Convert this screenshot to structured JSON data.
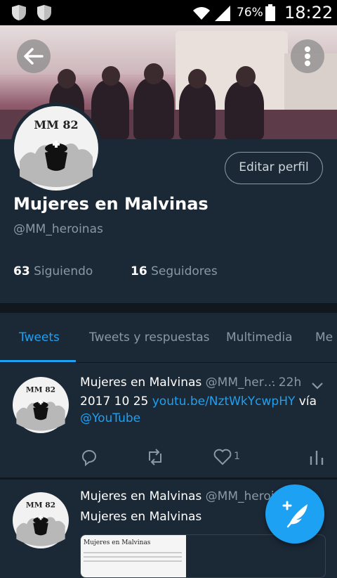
{
  "status_bar": {
    "battery": "76%",
    "time": "18:22",
    "icons": [
      "shield-icon",
      "shield-icon",
      "wifi-icon",
      "signal-icon",
      "battery-icon"
    ]
  },
  "header": {
    "back_icon": "arrow-left-icon",
    "more_icon": "more-vertical-icon"
  },
  "profile": {
    "avatar_text": "MM 82",
    "edit_button": "Editar perfil",
    "name": "Mujeres en Malvinas",
    "handle": "@MM_heroinas",
    "following_count": "63",
    "following_label": "Siguiendo",
    "followers_count": "16",
    "followers_label": "Seguidores"
  },
  "tabs": [
    {
      "label": "Tweets",
      "active": true
    },
    {
      "label": "Tweets y respuestas",
      "active": false
    },
    {
      "label": "Multimedia",
      "active": false
    },
    {
      "label": "Me",
      "active": false
    }
  ],
  "tweets": [
    {
      "author": "Mujeres en Malvinas",
      "handle": "@MM_her…",
      "time": "· 22h",
      "text_prefix": "2017 10 25 ",
      "link": "youtu.be/NztWkYcwpHY",
      "text_mid": " vía",
      "mention": "@YouTube",
      "like_count": "1"
    },
    {
      "author": "Mujeres en Malvinas",
      "handle": "@MM_heroi…",
      "text": "Mujeres en Malvinas",
      "card_title": "Mujeres en Malvinas"
    }
  ],
  "fab_icon": "compose-tweet-icon",
  "colors": {
    "background": "#1b2836",
    "accent": "#1da1f2",
    "muted": "#8899a6"
  }
}
